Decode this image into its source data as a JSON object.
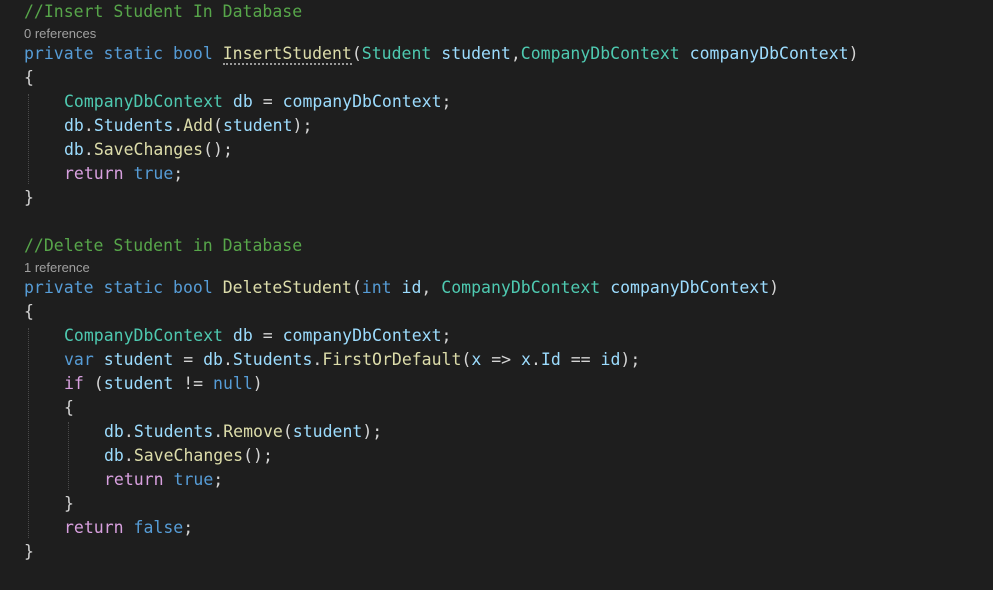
{
  "code": {
    "comment_insert": "//Insert Student In Database",
    "lens_insert": "0 references",
    "comment_delete": "//Delete Student in Database",
    "lens_delete": "1 reference",
    "kw_private": "private",
    "kw_static": "static",
    "kw_bool": "bool",
    "kw_int": "int",
    "kw_var": "var",
    "kw_if": "if",
    "kw_return": "return",
    "kw_true": "true",
    "kw_false": "false",
    "kw_null": "null",
    "fn_insert": "InsertStudent",
    "fn_delete": "DeleteStudent",
    "fn_add": "Add",
    "fn_savechanges": "SaveChanges",
    "fn_firstordefault": "FirstOrDefault",
    "fn_remove": "Remove",
    "type_student": "Student",
    "type_context": "CompanyDbContext",
    "id_student": "student",
    "id_companydbcontext": "companyDbContext",
    "id_db": "db",
    "id_students": "Students",
    "id_id": "id",
    "id_x": "x",
    "id_Id": "Id",
    "p_open_paren": "(",
    "p_close_paren": ")",
    "p_comma": ",",
    "p_comma_space": ", ",
    "p_space": " ",
    "p_assign": " = ",
    "p_semicolon": ";",
    "p_dot": ".",
    "p_close_stmt": ");",
    "p_empty_call": "();",
    "p_lambda": " => ",
    "p_eq": " == ",
    "p_neq": " != ",
    "p_if_open": " (",
    "brace_open": "{",
    "brace_close": "}"
  },
  "colors": {
    "background": "#1e1e1e",
    "comment": "#57a64a",
    "keyword": "#569cd6",
    "control_keyword": "#d8a0df",
    "type": "#4ec9b0",
    "method": "#dcdcaa",
    "identifier": "#9cdcfe",
    "punctuation": "#d4d4d4",
    "codelens": "#a0a0a0"
  }
}
